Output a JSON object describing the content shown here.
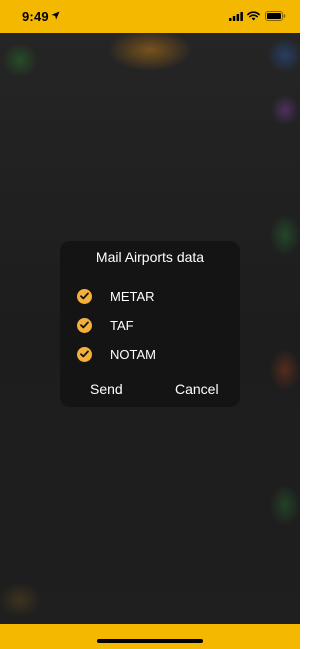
{
  "status_bar": {
    "time": "9:49",
    "icons": [
      "location-arrow-icon",
      "cellular-signal-icon",
      "wifi-icon",
      "battery-icon"
    ],
    "background_color": "#f5b800"
  },
  "dialog": {
    "title": "Mail Airports data",
    "options": [
      {
        "label": "METAR",
        "checked": true
      },
      {
        "label": "TAF",
        "checked": true
      },
      {
        "label": "NOTAM",
        "checked": true
      }
    ],
    "send_label": "Send",
    "cancel_label": "Cancel",
    "accent_color": "#f4b13a",
    "background_color": "#141414"
  },
  "bottom_bar": {
    "background_color": "#f5b800"
  }
}
